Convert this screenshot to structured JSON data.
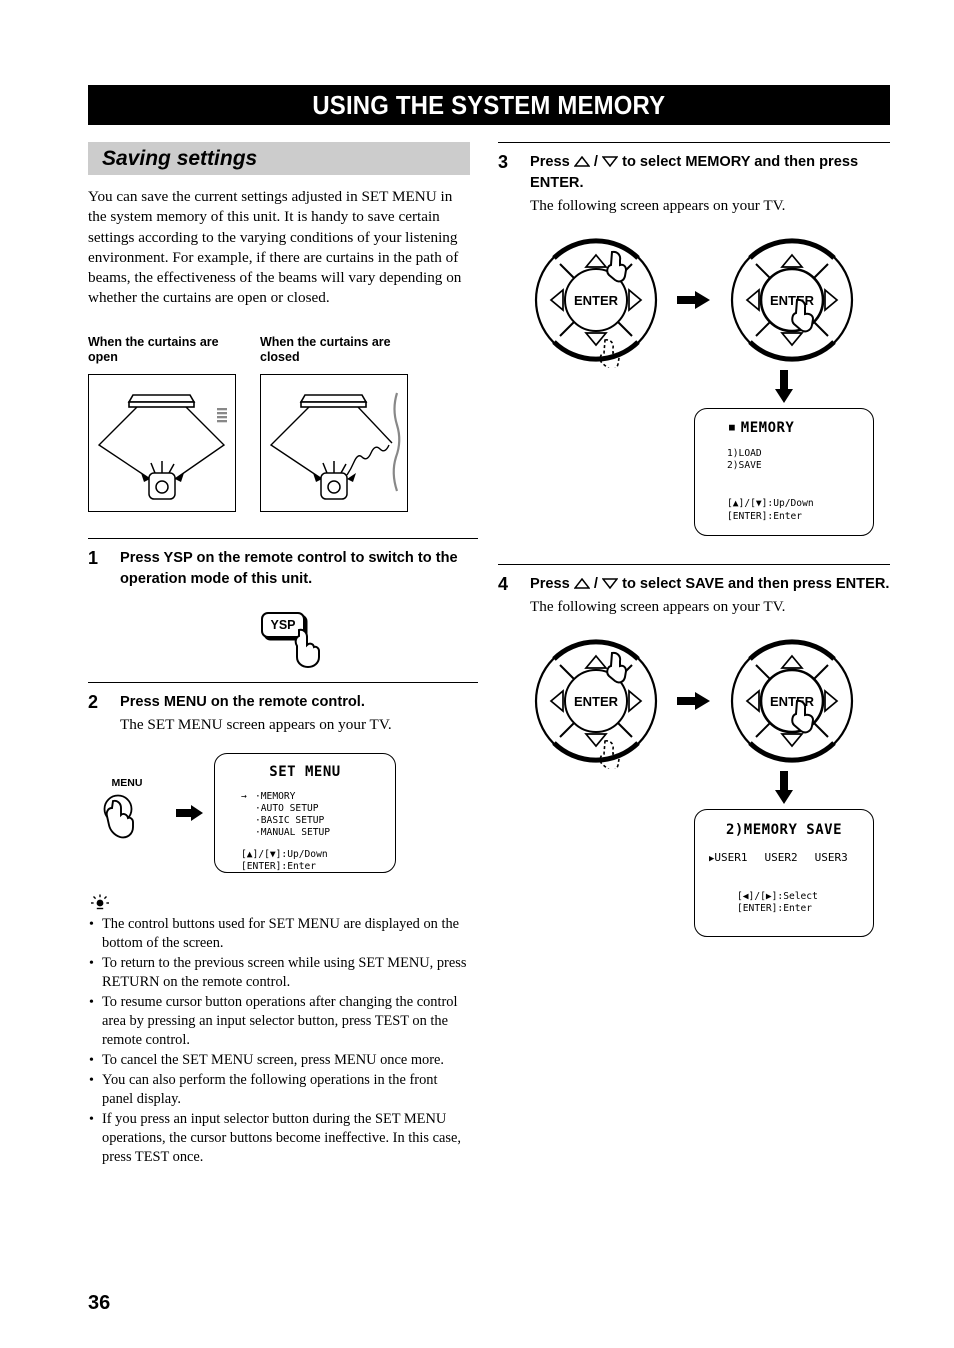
{
  "page": {
    "banner_title": "USING THE SYSTEM MEMORY",
    "page_number": "36"
  },
  "section": {
    "heading": "Saving settings",
    "intro": "You can save the current settings adjusted in SET MENU in the system memory of this unit. It is handy to save certain settings according to the varying conditions of your listening environment. For example, if there are curtains in the path of beams, the effectiveness of the beams will vary depending on whether the curtains are open or closed."
  },
  "figures": {
    "curtains_open_caption": "When the curtains are open",
    "curtains_closed_caption": "When the curtains are closed"
  },
  "steps": [
    {
      "number": "1",
      "title": "Press YSP on the remote control to switch to the operation mode of this unit.",
      "sub": "",
      "button_label": "YSP"
    },
    {
      "number": "2",
      "title": "Press MENU on the remote control.",
      "sub": "The SET MENU screen appears on your TV.",
      "button_label": "MENU"
    },
    {
      "number": "3",
      "title_pre": "Press",
      "title_mid": "/",
      "title_post": "to select MEMORY and then press ENTER.",
      "sub": "The following screen appears on your TV."
    },
    {
      "number": "4",
      "title_pre": "Press",
      "title_mid": "/",
      "title_post": "to select SAVE and then press ENTER.",
      "sub": "The following screen appears on your TV."
    }
  ],
  "osd_setmenu": {
    "title": "SET MENU",
    "cursor": "→",
    "items": [
      "·MEMORY",
      "·AUTO SETUP",
      "·BASIC SETUP",
      "·MANUAL SETUP"
    ],
    "hint1": "[▲]/[▼]:Up/Down",
    "hint2": "[ENTER]:Enter"
  },
  "osd_memory": {
    "title": "MEMORY",
    "bullet": "■",
    "items": [
      "1)LOAD",
      "2)SAVE"
    ],
    "hint1": "[▲]/[▼]:Up/Down",
    "hint2": "[ENTER]:Enter"
  },
  "osd_memory_save": {
    "title": "2)MEMORY SAVE",
    "cursor": "▶",
    "options": [
      "USER1",
      "USER2",
      "USER3"
    ],
    "hint1": "[◀]/[▶]:Select",
    "hint2": "[ENTER]:Enter"
  },
  "wheel": {
    "enter_label": "ENTER",
    "up_icon": "up-triangle-icon",
    "down_icon": "down-triangle-icon",
    "left_icon": "left-triangle-icon",
    "right_icon": "right-triangle-icon"
  },
  "tips": {
    "icon": "tip-bulb-icon",
    "items": [
      "The control buttons used for SET MENU are displayed on the bottom of the screen.",
      "To return to the previous screen while using SET MENU, press RETURN on the remote control.",
      "To resume cursor button operations after changing the control area by pressing an input selector button, press TEST on the remote control.",
      "To cancel the SET MENU screen, press MENU once more.",
      "You can also perform the following operations in the front panel display.",
      "If you press an input selector button during the SET MENU operations, the cursor buttons become ineffective. In this case, press TEST once."
    ]
  },
  "colors": {
    "banner_bg": "#000000",
    "banner_fg": "#ffffff",
    "section_heading_bg": "#cccccc",
    "ink": "#000000"
  }
}
